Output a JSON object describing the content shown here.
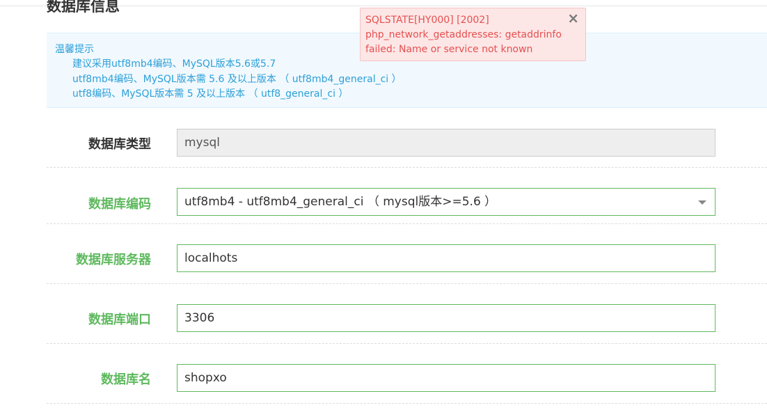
{
  "section": {
    "title": "数据库信息"
  },
  "tips": {
    "title": "温馨提示",
    "lines": [
      "建议采用utf8mb4编码、MySQL版本5.6或5.7",
      "utf8mb4编码、MySQL版本需 5.6 及以上版本 （ utf8mb4_general_ci ）",
      "utf8编码、MySQL版本需 5 及以上版本 （ utf8_general_ci ）"
    ]
  },
  "form": {
    "db_type": {
      "label": "数据库类型",
      "value": "mysql"
    },
    "db_charset": {
      "label": "数据库编码",
      "value": "utf8mb4 - utf8mb4_general_ci （ mysql版本>=5.6 ）"
    },
    "db_host": {
      "label": "数据库服务器",
      "value": "localhots"
    },
    "db_port": {
      "label": "数据库端口",
      "value": "3306"
    },
    "db_name": {
      "label": "数据库名",
      "value": "shopxo"
    }
  },
  "alert": {
    "lines": [
      "SQLSTATE[HY000] [2002]",
      "php_network_getaddresses: getaddrinfo",
      "failed: Name or service not known"
    ],
    "close_icon": "×"
  },
  "colors": {
    "success_green": "#5eb95e",
    "tip_blue": "#2d9fd8",
    "tip_background": "#f1f9fe",
    "error_red": "#e55050",
    "error_background": "#fde6e6"
  }
}
